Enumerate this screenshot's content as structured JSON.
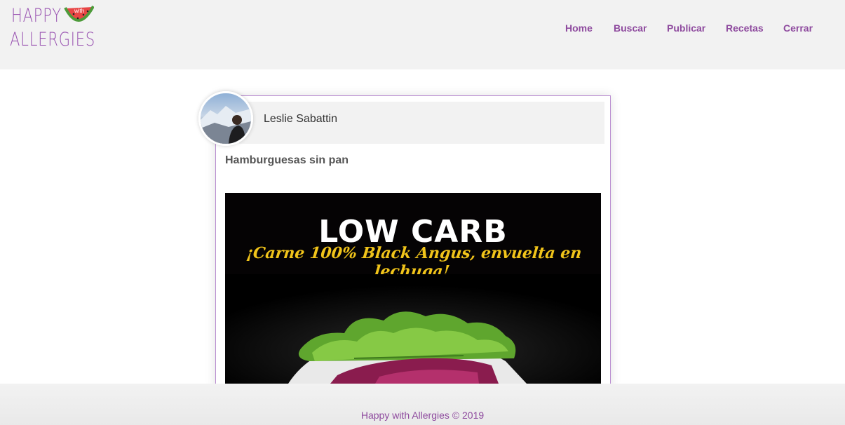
{
  "brand": {
    "logo_line1": "HAPPY",
    "logo_badge": "with",
    "logo_line2": "ALLERGIES",
    "accent_color": "#9a55b2"
  },
  "nav": {
    "items": [
      {
        "label": "Home"
      },
      {
        "label": "Buscar"
      },
      {
        "label": "Publicar"
      },
      {
        "label": "Recetas"
      },
      {
        "label": "Cerrar"
      }
    ]
  },
  "post": {
    "author": "Leslie Sabattin",
    "title": "Hamburguesas sin pan",
    "image": {
      "headline": "LOW CARB",
      "tagline": "¡Carne 100% Black Angus, envuelta en lechuga!"
    }
  },
  "footer": {
    "text": "Happy with Allergies © 2019"
  }
}
